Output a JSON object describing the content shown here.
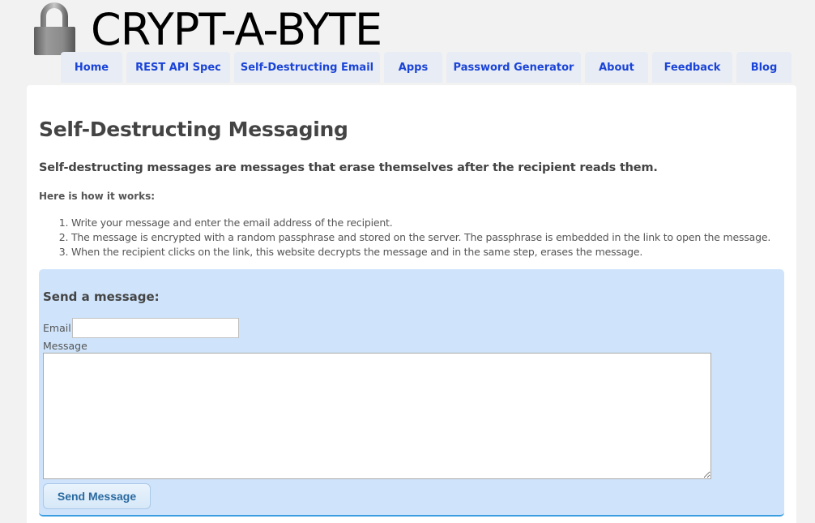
{
  "header": {
    "brand": "CRYPT-A-BYTE",
    "logo_icon": "padlock-icon"
  },
  "nav": {
    "tabs": [
      {
        "label": "Home"
      },
      {
        "label": "REST API Spec"
      },
      {
        "label": "Self-Destructing Email"
      },
      {
        "label": "Apps"
      },
      {
        "label": "Password Generator"
      },
      {
        "label": "About"
      },
      {
        "label": "Feedback"
      },
      {
        "label": "Blog"
      }
    ]
  },
  "main": {
    "title": "Self-Destructing Messaging",
    "intro": "Self-destructing messages are messages that erase themselves after the recipient reads them.",
    "how_heading": "Here is how it works:",
    "steps": [
      "Write your message and enter the email address of the recipient.",
      "The message is encrypted with a random passphrase and stored on the server. The passphrase is embedded in the link to open the message.",
      "When the recipient clicks on the link, this website decrypts the message and in the same step, erases the message."
    ]
  },
  "form": {
    "heading": "Send a message:",
    "email_label": "Email",
    "email_value": "",
    "message_label": "Message",
    "message_value": "",
    "send_label": "Send Message"
  },
  "colors": {
    "nav_link": "#1a44d8",
    "panel_bg": "#cfe4fb",
    "panel_border": "#3a9ee0",
    "button_text": "#2a6aa0"
  }
}
